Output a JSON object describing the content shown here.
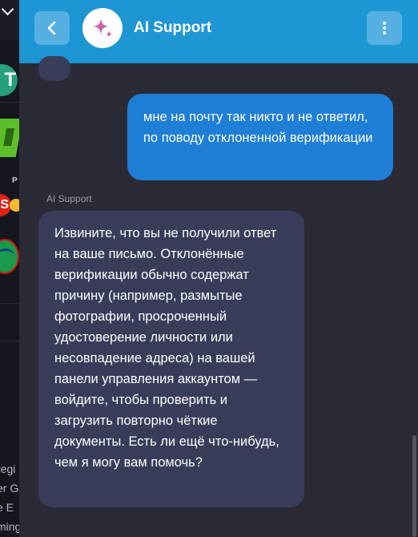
{
  "chat": {
    "title": "AI Support",
    "messages": [
      {
        "role": "user",
        "text": "мне на почту так никто и не ответил, по поводу отклоненной верификации"
      },
      {
        "role": "assistant",
        "sender": "AI Support",
        "text": "Извините, что вы не получили ответ на ваше письмо. Отклонённые верификации обычно содержат причину (например, размытые фотографии, просроченный удостоверение личности или несовпадение адреса) на вашей панели управления аккаунтом — войдите, чтобы проверить и загрузить повторно чёткие документы. Есть ли ещё что-нибудь, чем я могу вам помочь?"
      }
    ]
  },
  "background": {
    "letters": [
      "P",
      "S",
      "T"
    ],
    "fragments": [
      "regi",
      "er G",
      "e E",
      "ming"
    ]
  },
  "colors": {
    "header": "#1e96d3",
    "user_bubble": "#1f7ed6",
    "bot_bubble": "#393d59",
    "panel": "#2b2b38"
  },
  "icons": {
    "back": "chevron-left-icon",
    "avatar": "sparkle-icon",
    "menu": "more-vertical-icon"
  }
}
